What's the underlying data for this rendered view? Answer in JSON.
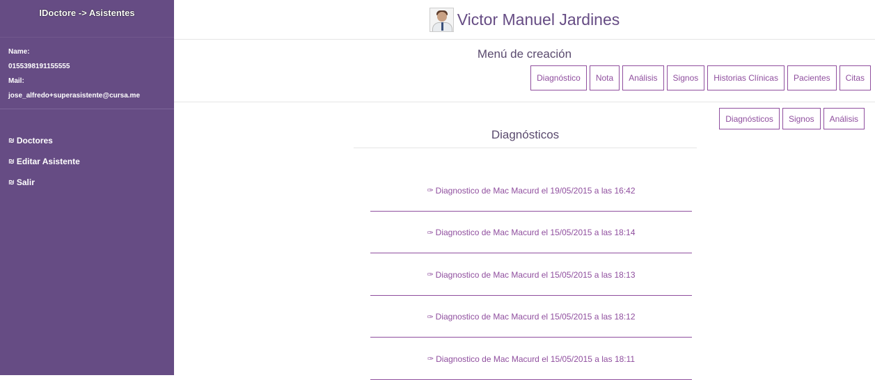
{
  "sidebar": {
    "brand": "IDoctore -> Asistentes",
    "name_label": "Name:",
    "phone": "0155398191155555",
    "mail_label": "Mail:",
    "email": "jose_alfredo+superasistente@cursa.me",
    "nav": [
      {
        "icon": "₪",
        "label": "Doctores"
      },
      {
        "icon": "₪",
        "label": "Editar Asistente"
      },
      {
        "icon": "₪",
        "label": "Salir"
      }
    ]
  },
  "header": {
    "user_name": "Victor Manuel Jardines"
  },
  "menu": {
    "title": "Menú de creación",
    "buttons": [
      "Diagnóstico",
      "Nota",
      "Análisis",
      "Signos",
      "Historias Clínicas",
      "Pacientes",
      "Citas"
    ]
  },
  "sub_menu": {
    "buttons": [
      "Diagnósticos",
      "Signos",
      "Análisis"
    ]
  },
  "section": {
    "title": "Diagnósticos",
    "arrow_icon": "✑",
    "items": [
      "Diagnostico de Mac Macurd el 19/05/2015 a las 16:42",
      "Diagnostico de Mac Macurd el 15/05/2015 a las 18:14",
      "Diagnostico de Mac Macurd el 15/05/2015 a las 18:13",
      "Diagnostico de Mac Macurd el 15/05/2015 a las 18:12",
      "Diagnostico de Mac Macurd el 15/05/2015 a las 18:11"
    ]
  },
  "colors": {
    "sidebar_bg": "#664c84",
    "accent": "#8f4e9e",
    "heading": "#5a4a6e"
  }
}
